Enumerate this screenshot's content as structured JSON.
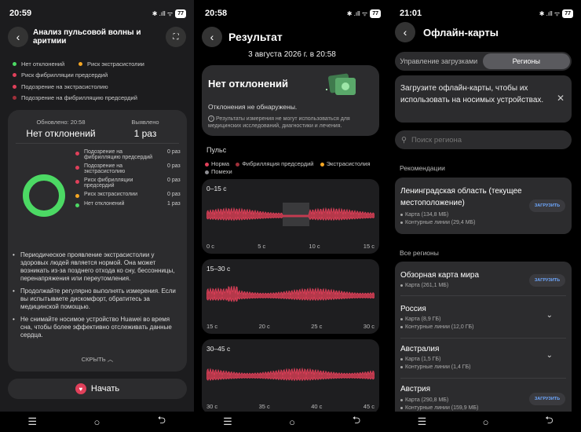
{
  "panel1": {
    "status": {
      "time": "20:59",
      "icons": "✱ .ıll ᯤ",
      "battery": "77"
    },
    "title": "Анализ пульсовой волны и аритмии",
    "legend": [
      {
        "label": "Нет отклонений",
        "color": "#4cd964"
      },
      {
        "label": "Риск экстрасистолии",
        "color": "#f5a623"
      },
      {
        "label": "Риск фибрилляции предсердий",
        "color": "#e0405a"
      },
      {
        "label": "Подозрение на экстрасистолию",
        "color": "#e0405a"
      },
      {
        "label": "Подозрение на фибрилляцию предсердий",
        "color": "#e0405a"
      }
    ],
    "updated_label": "Обновлено: 20:58",
    "updated_value": "Нет отклонений",
    "detected_label": "Выявлено",
    "detected_value": "1 раз",
    "breakdown": [
      {
        "label": "Подозрение на фибрилляцию предсердий",
        "count": "0 раз",
        "color": "#e0405a"
      },
      {
        "label": "Подозрение на экстрасистолию",
        "count": "0 раз",
        "color": "#e0405a"
      },
      {
        "label": "Риск фибрилляции предсердий",
        "count": "0 раз",
        "color": "#e0405a"
      },
      {
        "label": "Риск экстрасистолии",
        "count": "0 раз",
        "color": "#f5a623"
      },
      {
        "label": "Нет отклонений",
        "count": "1 раз",
        "color": "#4cd964"
      }
    ],
    "donut_fraction": 1.0,
    "bullets": [
      "Периодическое проявление экстрасистолии у здоровых людей является нормой. Она может возникать из-за позднего отхода ко сну, бессонницы, перенапряжения или переутомления.",
      "Продолжайте регулярно выполнять измерения. Если вы испытываете дискомфорт, обратитесь за медицинской помощью.",
      "Не снимайте носимое устройство Huawei во время сна, чтобы более эффективно отслеживать данные сердца."
    ],
    "collapse_label": "СКРЫТЬ",
    "start_label": "Начать"
  },
  "panel2": {
    "status": {
      "time": "20:58",
      "icons": "✱ .ıll ᯤ",
      "battery": "77"
    },
    "title": "Результат",
    "date": "3 августа 2026 г. в 20:58",
    "result_title": "Нет отклонений",
    "result_sub": "Отклонения не обнаружены.",
    "note": "Результаты измерения не могут использоваться для медицинских исследований, диагностики и лечения.",
    "pulse_label": "Пульс",
    "legend": [
      {
        "label": "Норма",
        "color": "#e0405a"
      },
      {
        "label": "Фибрилляция предсердий",
        "color": "#e0405a"
      },
      {
        "label": "Экстрасистолия",
        "color": "#f5a623"
      },
      {
        "label": "Помехи",
        "color": "#8e8e93"
      }
    ],
    "segments": [
      {
        "title": "0–15 с",
        "ticks": [
          "0 с",
          "5 с",
          "10 с",
          "15 с"
        ]
      },
      {
        "title": "15–30 с",
        "ticks": [
          "15 с",
          "20 с",
          "25 с",
          "30 с"
        ]
      },
      {
        "title": "30–45 с",
        "ticks": [
          "30 с",
          "35 с",
          "40 с",
          "45 с"
        ]
      }
    ]
  },
  "panel3": {
    "status": {
      "time": "21:01",
      "icons": "✱ .ıll ᯤ",
      "battery": "77"
    },
    "title": "Офлайн-карты",
    "tabs": [
      "Управление загрузками",
      "Регионы"
    ],
    "banner": "Загрузите офлайн-карты, чтобы их использовать на носимых устройствах.",
    "search_placeholder": "Поиск региона",
    "recommend_label": "Рекомендации",
    "all_label": "Все регионы",
    "download_label": "ЗАГРУЗИТЬ",
    "recommended": {
      "name": "Ленинградская область (текущее местоположение)",
      "map": "Карта (134,8 МБ)",
      "contours": "Контурные линии (29,4 МБ)"
    },
    "regions": [
      {
        "name": "Обзорная карта мира",
        "map": "Карта (261,1 МБ)",
        "contours": ""
      },
      {
        "name": "Россия",
        "map": "Карта (8,9 ГБ)",
        "contours": "Контурные линии (12,0 ГБ)"
      },
      {
        "name": "Австралия",
        "map": "Карта (1,5 ГБ)",
        "contours": "Контурные линии (1,4 ГБ)"
      },
      {
        "name": "Австрия",
        "map": "Карта (290,8 МБ)",
        "contours": "Контурные линии (159,9 МБ)"
      }
    ]
  },
  "colors": {
    "normal": "#4cd964",
    "extrasystole": "#f5a623",
    "afib": "#e0405a",
    "accent": "#6ea8ff"
  }
}
